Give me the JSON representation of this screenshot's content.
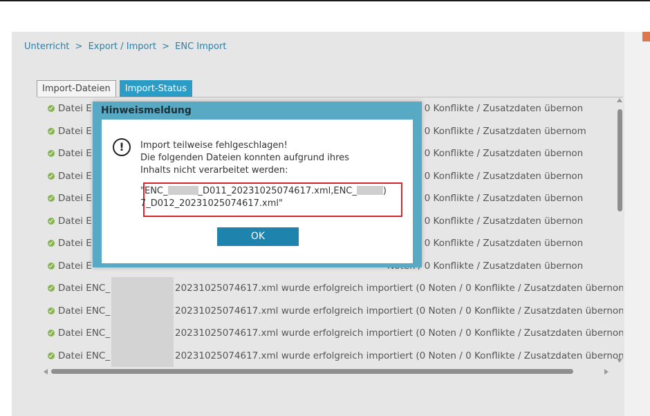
{
  "breadcrumb": {
    "items": [
      "Unterricht",
      "Export / Import",
      "ENC Import"
    ],
    "separator": ">"
  },
  "tabs": [
    {
      "label": "Import-Dateien",
      "active": false
    },
    {
      "label": "Import-Status",
      "active": true
    }
  ],
  "status_rows": [
    {
      "prefix": "Datei E",
      "tail": "Noten / 0 Konflikte / Zusatzdaten übernon"
    },
    {
      "prefix": "Datei E",
      "tail": "Noten / 0 Konflikte / Zusatzdaten übernom"
    },
    {
      "prefix": "Datei E",
      "tail": "Noten / 0 Konflikte / Zusatzdaten übernon"
    },
    {
      "prefix": "Datei E",
      "tail": "Noten / 0 Konflikte / Zusatzdaten übernon"
    },
    {
      "prefix": "Datei E",
      "tail": "Noten / 0 Konflikte / Zusatzdaten übernon"
    },
    {
      "prefix": "Datei E",
      "tail": "Noten / 0 Konflikte / Zusatzdaten übernon"
    },
    {
      "prefix": "Datei E",
      "tail": "Noten / 0 Konflikte / Zusatzdaten übernon"
    },
    {
      "prefix": "Datei E",
      "tail": "Noten / 0 Konflikte / Zusatzdaten übernon"
    },
    {
      "prefix": "Datei ENC_",
      "tail": "20231025074617.xml wurde erfolgreich importiert (0 Noten / 0 Konflikte / Zusatzdaten übernon"
    },
    {
      "prefix": "Datei ENC_",
      "tail": "20231025074617.xml wurde erfolgreich importiert (0 Noten / 0 Konflikte / Zusatzdaten übernon"
    },
    {
      "prefix": "Datei ENC_",
      "tail": "20231025074617.xml wurde erfolgreich importiert (0 Noten / 0 Konflikte / Zusatzdaten übernon"
    },
    {
      "prefix": "Datei ENC_",
      "tail": "20231025074617.xml wurde erfolgreich importiert (0 Noten / 0 Konflikte / Zusatzdaten übernon"
    }
  ],
  "dialog": {
    "title": "Hinweismeldung",
    "icon": "alert-circle-icon",
    "message_lines": [
      "Import teilweise fehlgeschlagen!",
      "Die folgenden Dateien konnten aufgrund ihres",
      "Inhalts nicht verarbeitet werden:"
    ],
    "file_line_1a": "\"ENC_",
    "file_line_1b": "_D011_20231025074617.xml,ENC_",
    "file_line_1c": ")",
    "file_line_2": "7_D012_20231025074617.xml\"",
    "ok_label": "OK"
  },
  "colors": {
    "accent": "#2a9cc6",
    "dialog_frame": "#58a9c4",
    "ok_button": "#1e83ad",
    "highlight_border": "#d9232c",
    "success_icon": "#86b44e"
  }
}
